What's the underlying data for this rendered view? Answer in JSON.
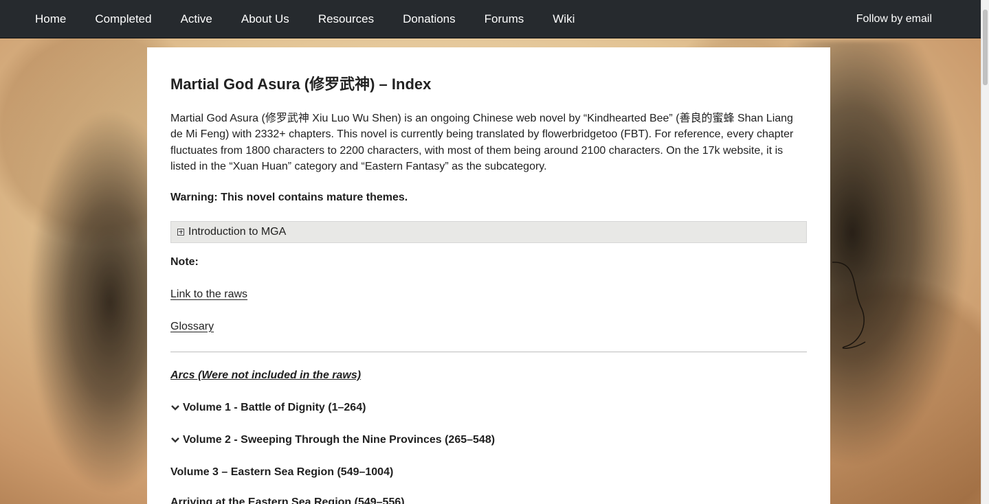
{
  "nav": {
    "items": [
      "Home",
      "Completed",
      "Active",
      "About Us",
      "Resources",
      "Donations",
      "Forums",
      "Wiki"
    ],
    "follow_label": "Follow by email"
  },
  "post": {
    "title": "Martial God Asura (修罗武神) – Index",
    "intro": "Martial God Asura (修罗武神 Xiu Luo Wu Shen) is an ongoing Chinese web novel by “Kindhearted Bee” (善良的蜜蜂 Shan Liang de Mi Feng) with 2332+ chapters. This novel is currently being translated by flowerbridgetoo (FBT). For reference, every chapter fluctuates from 1800 characters to 2200 characters, with most of them being around 2100 characters. On the 17k website, it is listed in the “Xuan Huan” category and “Eastern Fantasy” as the subcategory.",
    "warning": "Warning: This novel contains mature themes.",
    "spoiler_label": "Introduction to MGA",
    "note_label": "Note:",
    "raws_link": "Link to the raws",
    "glossary_link": "Glossary",
    "arcs_label": "Arcs (Were not included in the raws)",
    "volumes": [
      "Volume 1 - Battle of Dignity (1–264)",
      "Volume 2 - Sweeping Through the Nine Provinces (265–548)"
    ],
    "volume3": "Volume 3 – Eastern Sea Region (549–1004)",
    "arrival": "Arriving at the Eastern Sea Region (549–556)"
  }
}
